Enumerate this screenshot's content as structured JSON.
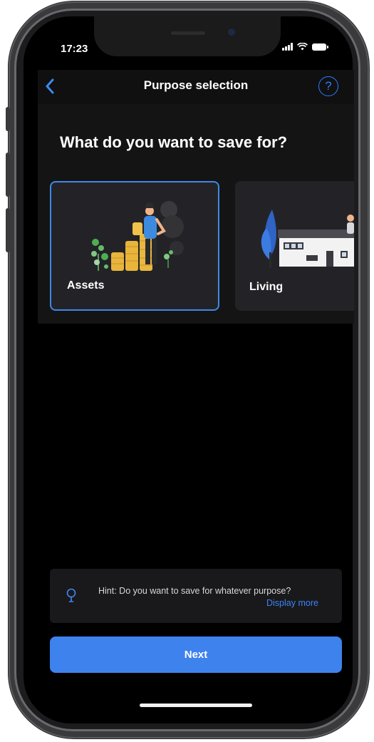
{
  "status_bar": {
    "time": "17:23"
  },
  "header": {
    "title": "Purpose selection",
    "back_icon": "chevron-left-icon",
    "help_symbol": "?"
  },
  "main": {
    "question": "What do you want to save for?",
    "cards": [
      {
        "label": "Assets",
        "selected": true,
        "icon": "coins-person-illustration"
      },
      {
        "label": "Living",
        "selected": false,
        "icon": "house-illustration"
      }
    ]
  },
  "hint": {
    "text": "Hint: Do you want to save for whatever purpose?",
    "link": "Display more",
    "icon": "lightbulb-icon"
  },
  "footer": {
    "next_label": "Next"
  },
  "colors": {
    "accent": "#3e82ee",
    "background": "#000000",
    "card": "#232327",
    "selected_border": "#3f88e8"
  }
}
